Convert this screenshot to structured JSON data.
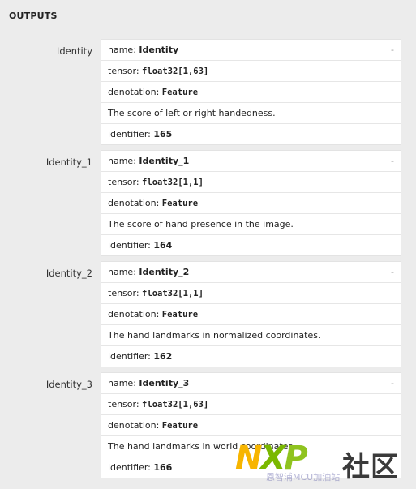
{
  "section": {
    "title": "OUTPUTS"
  },
  "outputs": [
    {
      "label": "Identity",
      "name_key": "name: ",
      "name": "Identity",
      "tensor_key": "tensor: ",
      "tensor": "float32[1,63]",
      "denotation_key": "denotation: ",
      "denotation": "Feature",
      "description": "The score of left or right handedness.",
      "identifier_key": "identifier: ",
      "identifier": "165",
      "toggle": "-"
    },
    {
      "label": "Identity_1",
      "name_key": "name: ",
      "name": "Identity_1",
      "tensor_key": "tensor: ",
      "tensor": "float32[1,1]",
      "denotation_key": "denotation: ",
      "denotation": "Feature",
      "description": "The score of hand presence in the image.",
      "identifier_key": "identifier: ",
      "identifier": "164",
      "toggle": "-"
    },
    {
      "label": "Identity_2",
      "name_key": "name: ",
      "name": "Identity_2",
      "tensor_key": "tensor: ",
      "tensor": "float32[1,1]",
      "denotation_key": "denotation: ",
      "denotation": "Feature",
      "description": "The hand landmarks in normalized coordinates.",
      "identifier_key": "identifier: ",
      "identifier": "162",
      "toggle": "-"
    },
    {
      "label": "Identity_3",
      "name_key": "name: ",
      "name": "Identity_3",
      "tensor_key": "tensor: ",
      "tensor": "float32[1,63]",
      "denotation_key": "denotation: ",
      "denotation": "Feature",
      "description": "The hand landmarks in world coordinates.",
      "identifier_key": "identifier: ",
      "identifier": "166",
      "toggle": "-"
    }
  ],
  "watermark": {
    "logo_n": "N",
    "logo_x": "X",
    "logo_p": "P",
    "text": "社区",
    "sub": "恩智浦MCU加油站"
  }
}
